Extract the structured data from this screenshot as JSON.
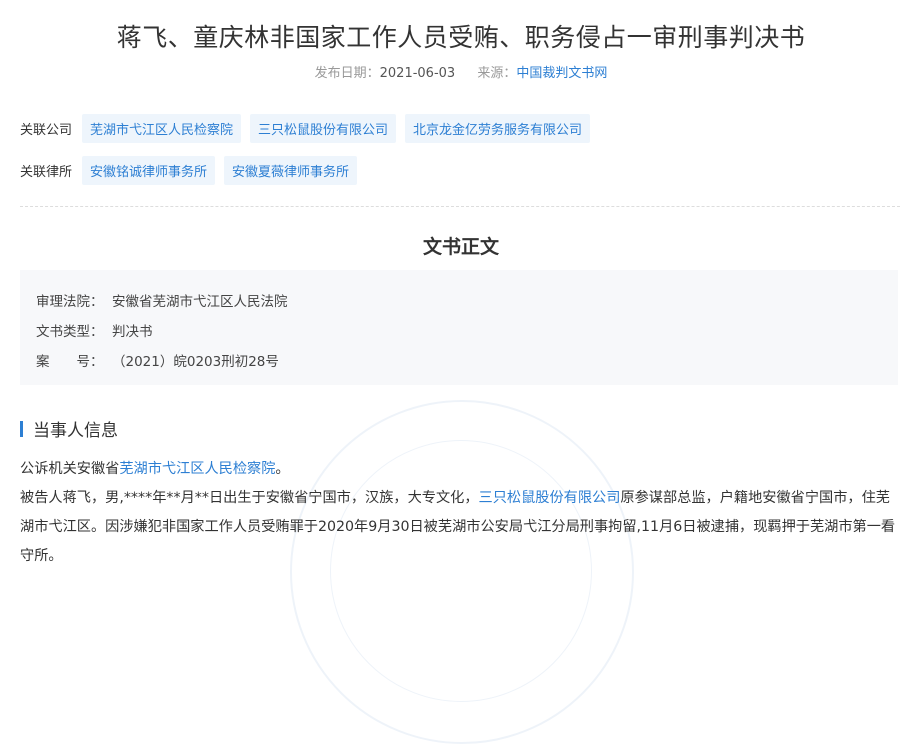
{
  "title": "蒋飞、童庆林非国家工作人员受贿、职务侵占一审刑事判决书",
  "meta": {
    "date_label": "发布日期：",
    "date": "2021-06-03",
    "source_label": "来源：",
    "source": "中国裁判文书网"
  },
  "related_companies": {
    "label": "关联公司",
    "items": [
      "芜湖市弋江区人民检察院",
      "三只松鼠股份有限公司",
      "北京龙金亿劳务服务有限公司"
    ]
  },
  "related_lawfirms": {
    "label": "关联律所",
    "items": [
      "安徽铭诚律师事务所",
      "安徽夏薇律师事务所"
    ]
  },
  "section_title": "文书正文",
  "info": {
    "court_label": "审理法院：",
    "court": "安徽省芜湖市弋江区人民法院",
    "type_label": "文书类型：",
    "type": "判决书",
    "case_label": "案　　号：",
    "case_no": "（2021）皖0203刑初28号"
  },
  "party_heading": "当事人信息",
  "party": {
    "p1_pre": "公诉机关安徽省",
    "p1_link": "芜湖市弋江区人民检察院",
    "p1_post": "。",
    "p2_pre": "被告人蒋飞，男,****年**月**日出生于安徽省宁国市，汉族，大专文化，",
    "p2_link": "三只松鼠股份有限公司",
    "p2_post": "原参谋部总监，户籍地安徽省宁国市，住芜湖市弋江区。因涉嫌犯非国家工作人员受贿罪于2020年9月30日被芜湖市公安局弋江分局刑事拘留,11月6日被逮捕，现羁押于芜湖市第一看守所。"
  }
}
